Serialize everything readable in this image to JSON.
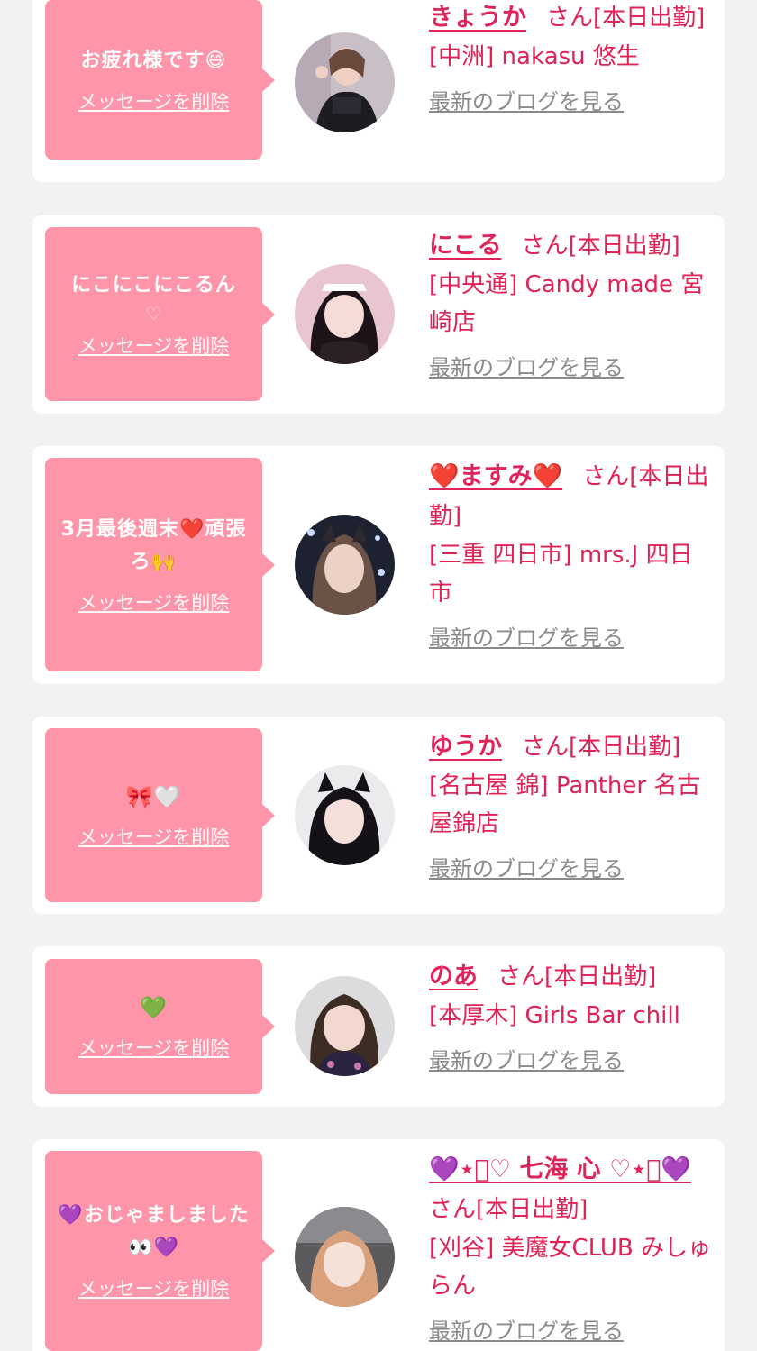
{
  "ui": {
    "delete_label": "メッセージを削除",
    "blog_label": "最新のブログを見る",
    "accent_color": "#fe95a8",
    "name_color": "#e0245a"
  },
  "cards": [
    {
      "message": "お疲れ様です😄",
      "message_extra": "",
      "name": "きょうか",
      "status": "さん[本日出勤]",
      "shop": "[中洲] nakasu 悠生"
    },
    {
      "message": "にこにこにこるん",
      "message_extra": "♡",
      "name": "にこる",
      "status": "さん[本日出勤]",
      "shop": "[中央通] Candy made 宮崎店"
    },
    {
      "message": "3月最後週末❤️頑張ろ🙌",
      "message_extra": "",
      "name": "❤️ますみ❤️",
      "status": "さん[本日出勤]",
      "shop": "[三重 四日市] mrs.J 四日市"
    },
    {
      "message": "🎀🤍",
      "message_extra": "",
      "name": "ゆうか",
      "status": "さん[本日出勤]",
      "shop": "[名古屋 錦] Panther 名古屋錦店"
    },
    {
      "message": "💚",
      "message_extra": "",
      "name": "のあ",
      "status": "さん[本日出勤]",
      "shop": "[本厚木] Girls Bar chill"
    },
    {
      "message": "💜おじゃましました👀💜",
      "message_extra": "",
      "name": "💜⋆͛♡ 七海 心 ♡⋆͛💜",
      "status": "さん[本日出勤]",
      "shop": "[刈谷] 美魔女CLUB みしゅらん"
    }
  ]
}
